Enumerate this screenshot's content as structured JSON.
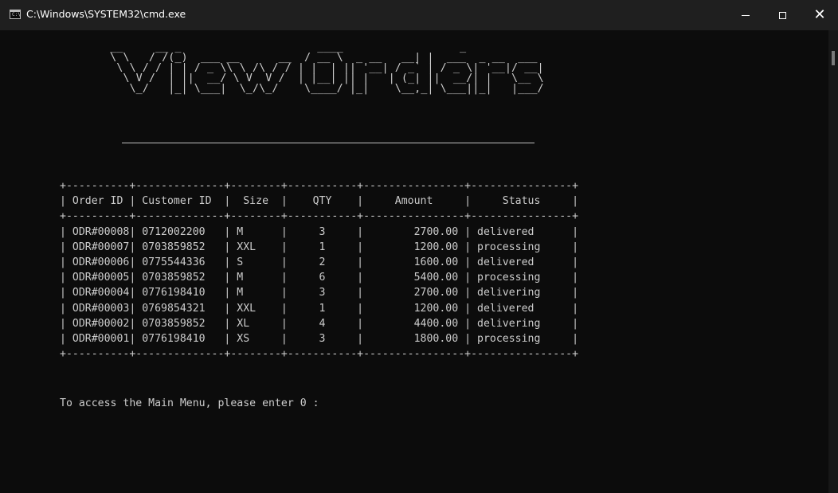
{
  "window": {
    "title": "C:\\Windows\\SYSTEM32\\cmd.exe",
    "icon_label": "C:\\",
    "close_symbol": "✕"
  },
  "banner": {
    "title_text": "ViewOrders"
  },
  "table": {
    "headers": [
      "Order ID",
      "Customer ID",
      "Size",
      "QTY",
      "Amount",
      "Status"
    ],
    "rows": [
      [
        "ODR#00008",
        "0712002200",
        "M",
        "3",
        "2700.00",
        "delivered"
      ],
      [
        "ODR#00007",
        "0703859852",
        "XXL",
        "1",
        "1200.00",
        "processing"
      ],
      [
        "ODR#00006",
        "0775544336",
        "S",
        "2",
        "1600.00",
        "delivered"
      ],
      [
        "ODR#00005",
        "0703859852",
        "M",
        "6",
        "5400.00",
        "processing"
      ],
      [
        "ODR#00004",
        "0776198410",
        "M",
        "3",
        "2700.00",
        "delivering"
      ],
      [
        "ODR#00003",
        "0769854321",
        "XXL",
        "1",
        "1200.00",
        "delivered"
      ],
      [
        "ODR#00002",
        "0703859852",
        "XL",
        "4",
        "4400.00",
        "delivering"
      ],
      [
        "ODR#00001",
        "0776198410",
        "XS",
        "3",
        "1800.00",
        "processing"
      ]
    ]
  },
  "prompt": {
    "text": "To access the Main Menu, please enter 0 :"
  },
  "colors": {
    "console_bg": "#0c0c0c",
    "titlebar_bg": "#1f1f1f",
    "text": "#cccccc"
  }
}
